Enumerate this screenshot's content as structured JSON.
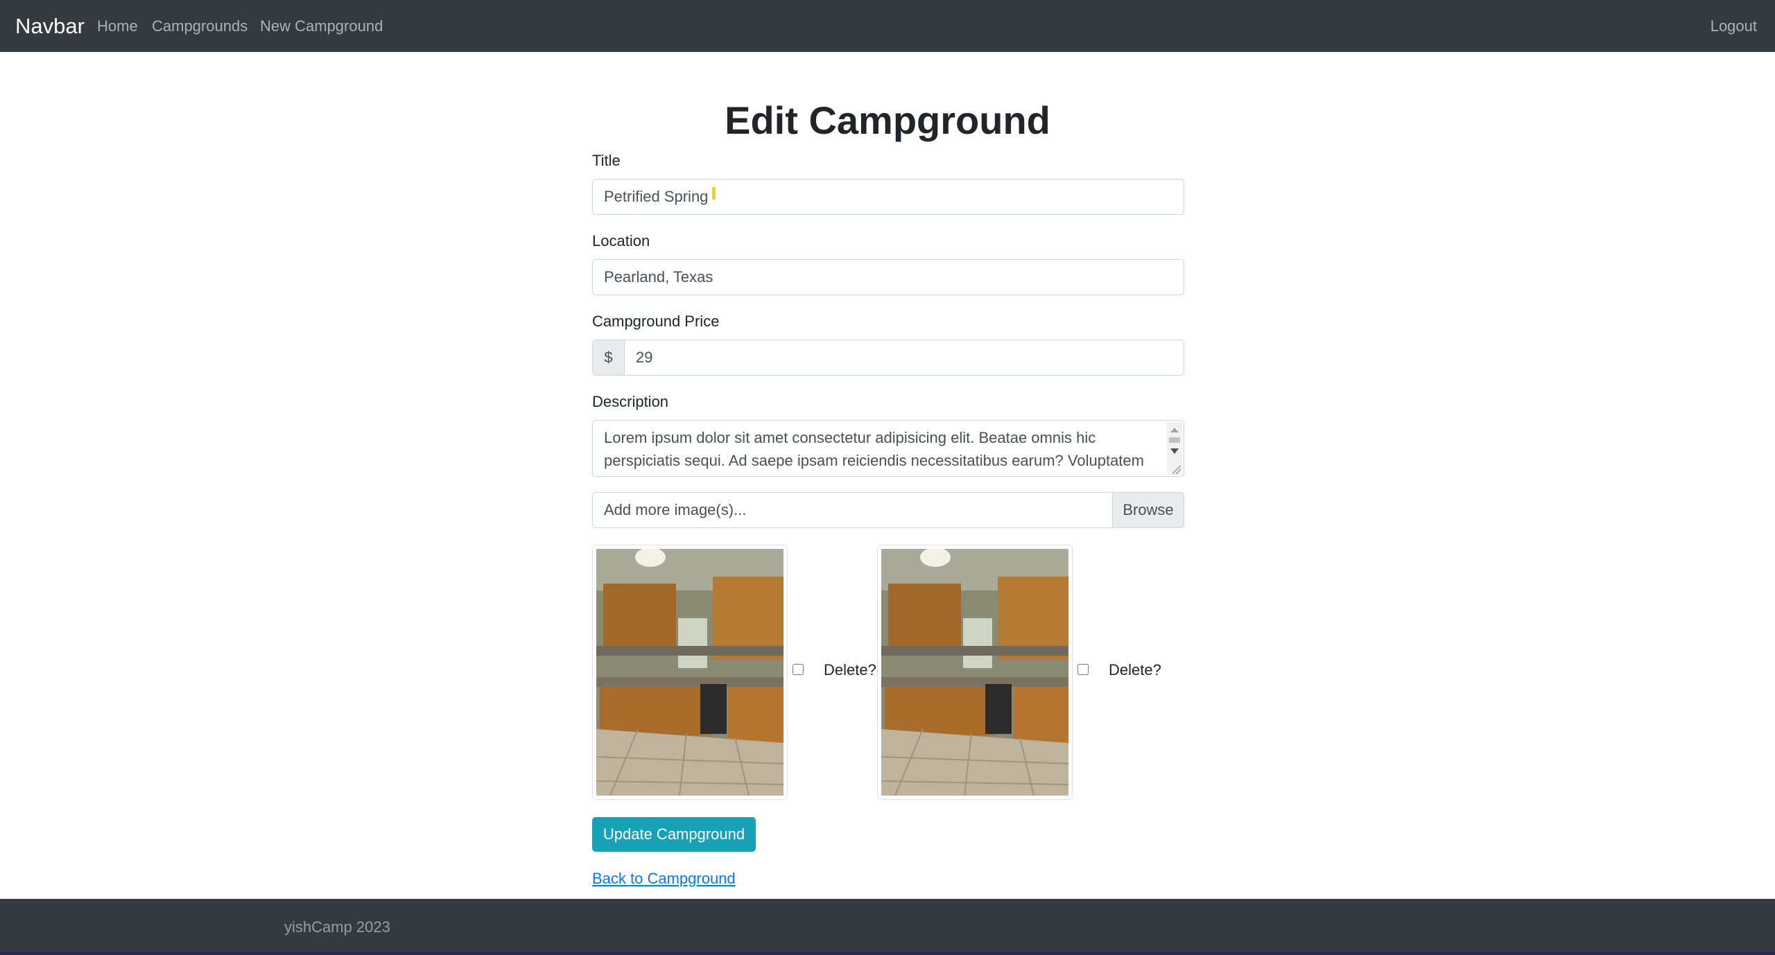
{
  "navbar": {
    "brand": "Navbar",
    "links": [
      "Home",
      "Campgrounds",
      "New Campground"
    ],
    "logout": "Logout"
  },
  "page": {
    "title": "Edit Campground"
  },
  "form": {
    "title_label": "Title",
    "title_value": "Petrified Spring",
    "location_label": "Location",
    "location_value": "Pearland, Texas",
    "price_label": "Campground Price",
    "price_currency": "$",
    "price_value": "29",
    "description_label": "Description",
    "description_value": "Lorem ipsum dolor sit amet consectetur adipisicing elit. Beatae omnis hic perspiciatis sequi. Ad saepe ipsam reiciendis necessitatibus earum? Voluptatem",
    "file_placeholder": "Add more image(s)...",
    "browse_label": "Browse",
    "images": [
      {
        "delete_label": "Delete?"
      },
      {
        "delete_label": "Delete?"
      }
    ],
    "submit_label": "Update Campground",
    "back_link": "Back to Campground"
  },
  "footer": {
    "text": "yishCamp 2023"
  },
  "colors": {
    "navbar_bg": "#343a40",
    "accent_button": "#17a2b8",
    "link": "#007bff"
  }
}
